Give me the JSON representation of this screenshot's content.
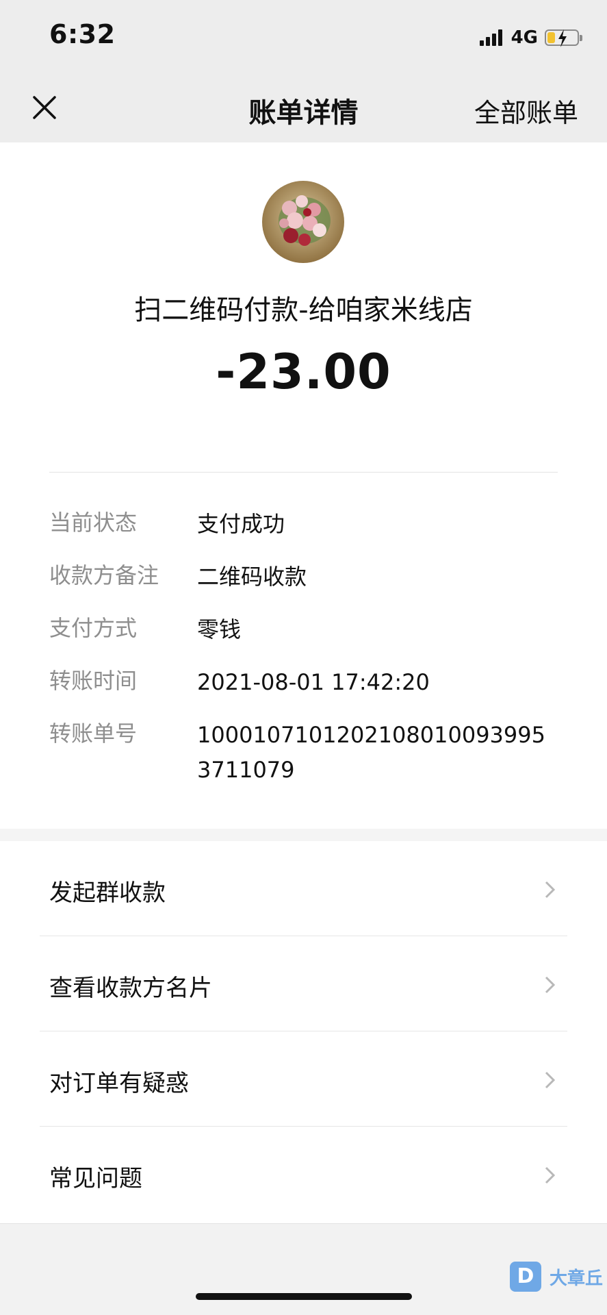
{
  "status_bar": {
    "time": "6:32",
    "network": "4G",
    "icons": [
      "signal-icon",
      "battery-charging-icon"
    ]
  },
  "nav": {
    "close_icon": "close-icon",
    "title": "账单详情",
    "all_bills": "全部账单"
  },
  "transaction": {
    "merchant_title": "扫二维码付款-给咱家米线店",
    "amount": "-23.00"
  },
  "details": [
    {
      "label": "当前状态",
      "value": "支付成功"
    },
    {
      "label": "收款方备注",
      "value": "二维码收款"
    },
    {
      "label": "支付方式",
      "value": "零钱"
    },
    {
      "label": "转账时间",
      "value": "2021-08-01 17:42:20"
    },
    {
      "label": "转账单号",
      "value": "10001071012021080100939953711079"
    }
  ],
  "actions": [
    {
      "label": "发起群收款",
      "icon": "chevron-right-icon"
    },
    {
      "label": "查看收款方名片",
      "icon": "chevron-right-icon"
    },
    {
      "label": "对订单有疑惑",
      "icon": "chevron-right-icon"
    },
    {
      "label": "常见问题",
      "icon": "chevron-right-icon"
    }
  ],
  "watermark": {
    "badge": "D",
    "text": "大章丘"
  },
  "colors": {
    "header_bg": "#ededed",
    "label_gray": "#8e8e8e",
    "text": "#111111",
    "watermark_blue": "#6fa8e6"
  }
}
